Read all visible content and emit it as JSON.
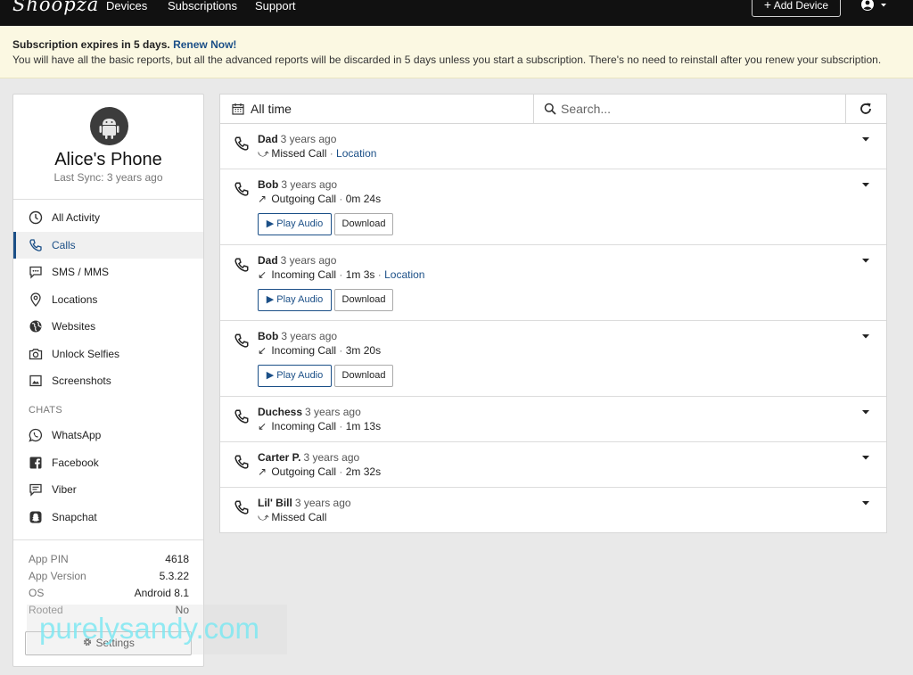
{
  "nav": {
    "logo": "Shoopza",
    "links": [
      "Devices",
      "Subscriptions",
      "Support"
    ],
    "add_device": "Add Device"
  },
  "banner": {
    "title": "Subscription expires in 5 days.",
    "renew_link": "Renew Now!",
    "message": "You will have all the basic reports, but all the advanced reports will be discarded in 5 days unless you start a subscription. There's no need to reinstall after you renew your subscription."
  },
  "device": {
    "name": "Alice's Phone",
    "last_sync": "Last Sync: 3 years ago"
  },
  "sidebar": {
    "items": [
      {
        "label": "All Activity",
        "icon": "clock-icon"
      },
      {
        "label": "Calls",
        "icon": "phone-icon"
      },
      {
        "label": "SMS / MMS",
        "icon": "message-icon"
      },
      {
        "label": "Locations",
        "icon": "location-pin-icon"
      },
      {
        "label": "Websites",
        "icon": "globe-icon"
      },
      {
        "label": "Unlock Selfies",
        "icon": "camera-icon"
      },
      {
        "label": "Screenshots",
        "icon": "image-icon"
      }
    ],
    "chats_heading": "CHATS",
    "chats": [
      {
        "label": "WhatsApp",
        "icon": "whatsapp-icon"
      },
      {
        "label": "Facebook",
        "icon": "facebook-icon"
      },
      {
        "label": "Viber",
        "icon": "viber-icon"
      },
      {
        "label": "Snapchat",
        "icon": "snapchat-icon"
      }
    ],
    "info": [
      {
        "key": "App PIN",
        "value": "4618"
      },
      {
        "key": "App Version",
        "value": "5.3.22"
      },
      {
        "key": "OS",
        "value": "Android 8.1"
      },
      {
        "key": "Rooted",
        "value": "No"
      }
    ],
    "settings_label": "Settings"
  },
  "toolbar": {
    "range": "All time",
    "search_placeholder": "Search..."
  },
  "calls": [
    {
      "contact": "Dad",
      "ago": "3 years ago",
      "type": "Missed Call",
      "arrow": "⤻",
      "duration": "",
      "location": "Location",
      "audio": false
    },
    {
      "contact": "Bob",
      "ago": "3 years ago",
      "type": "Outgoing Call",
      "arrow": "↗",
      "duration": "0m 24s",
      "location": "",
      "audio": true
    },
    {
      "contact": "Dad",
      "ago": "3 years ago",
      "type": "Incoming Call",
      "arrow": "↙",
      "duration": "1m 3s",
      "location": "Location",
      "audio": true
    },
    {
      "contact": "Bob",
      "ago": "3 years ago",
      "type": "Incoming Call",
      "arrow": "↙",
      "duration": "3m 20s",
      "location": "",
      "audio": true
    },
    {
      "contact": "Duchess",
      "ago": "3 years ago",
      "type": "Incoming Call",
      "arrow": "↙",
      "duration": "1m 13s",
      "location": "",
      "audio": false
    },
    {
      "contact": "Carter P.",
      "ago": "3 years ago",
      "type": "Outgoing Call",
      "arrow": "↗",
      "duration": "2m 32s",
      "location": "",
      "audio": false
    },
    {
      "contact": "Lil' Bill",
      "ago": "3 years ago",
      "type": "Missed Call",
      "arrow": "⤻",
      "duration": "",
      "location": "",
      "audio": false
    }
  ],
  "call_buttons": {
    "play": "Play Audio",
    "download": "Download"
  },
  "watermark": "purelysandy.com",
  "colors": {
    "accent": "#1b4f87",
    "nav_bg": "#111111",
    "banner_bg": "#fbf8e2"
  }
}
